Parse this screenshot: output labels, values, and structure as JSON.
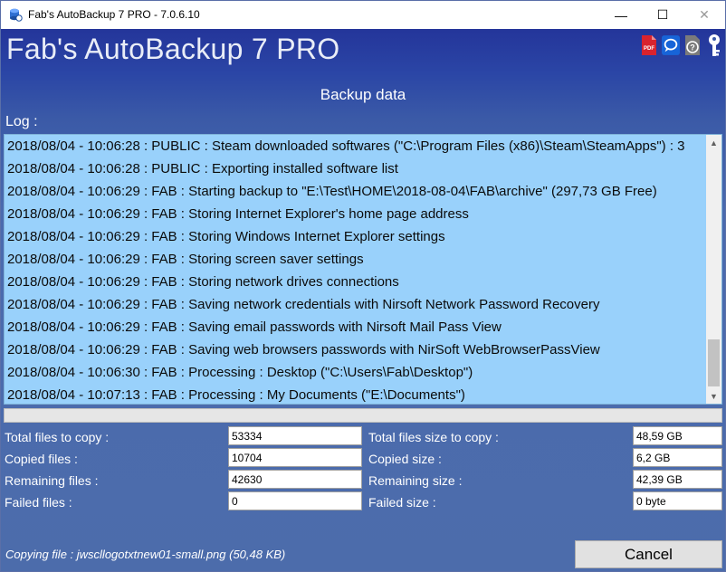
{
  "window": {
    "title": "Fab's AutoBackup 7 PRO - 7.0.6.10",
    "minimize_glyph": "—",
    "maximize_glyph": "☐",
    "close_glyph": "✕"
  },
  "header": {
    "app_title": "Fab's AutoBackup 7 PRO",
    "icons": [
      "pdf-icon",
      "chat-icon",
      "help-icon",
      "key-icon"
    ],
    "pdf_icon_text": "PDF",
    "help_icon_text": "?"
  },
  "section_title": "Backup data",
  "log": {
    "label": "Log :",
    "lines": [
      "2018/08/04 - 10:06:28 : PUBLIC : Steam downloaded softwares (\"C:\\Program Files (x86)\\Steam\\SteamApps\") : 3",
      "2018/08/04 - 10:06:28 : PUBLIC : Exporting installed software list",
      "2018/08/04 - 10:06:29 : FAB : Starting backup to \"E:\\Test\\HOME\\2018-08-04\\FAB\\archive\" (297,73 GB Free)",
      "2018/08/04 - 10:06:29 : FAB : Storing Internet Explorer's home page address",
      "2018/08/04 - 10:06:29 : FAB : Storing Windows Internet Explorer settings",
      "2018/08/04 - 10:06:29 : FAB : Storing screen saver settings",
      "2018/08/04 - 10:06:29 : FAB : Storing network drives connections",
      "2018/08/04 - 10:06:29 : FAB : Saving network credentials with Nirsoft Network Password Recovery",
      "2018/08/04 - 10:06:29 : FAB : Saving email passwords with Nirsoft Mail Pass View",
      "2018/08/04 - 10:06:29 : FAB : Saving web browsers passwords with NirSoft WebBrowserPassView",
      "2018/08/04 - 10:06:30 : FAB : Processing : Desktop (\"C:\\Users\\Fab\\Desktop\")",
      "2018/08/04 - 10:07:13 : FAB : Processing : My Documents (\"E:\\Documents\")"
    ],
    "scroll_up": "▲",
    "scroll_down": "▼"
  },
  "progress": {
    "value": 0
  },
  "stats": {
    "total_files_label": "Total files to copy :",
    "total_files_value": "53334",
    "copied_files_label": "Copied files :",
    "copied_files_value": "10704",
    "remaining_files_label": "Remaining files :",
    "remaining_files_value": "42630",
    "failed_files_label": "Failed files :",
    "failed_files_value": "0",
    "total_size_label": "Total files size to copy :",
    "total_size_value": "48,59 GB",
    "copied_size_label": "Copied size :",
    "copied_size_value": "6,2 GB",
    "remaining_size_label": "Remaining size :",
    "remaining_size_value": "42,39 GB",
    "failed_size_label": "Failed size :",
    "failed_size_value": "0 byte"
  },
  "status": {
    "copying_text": "Copying file : jwscllogotxtnew01-small.png (50,48 KB)"
  },
  "buttons": {
    "cancel_label": "Cancel"
  }
}
